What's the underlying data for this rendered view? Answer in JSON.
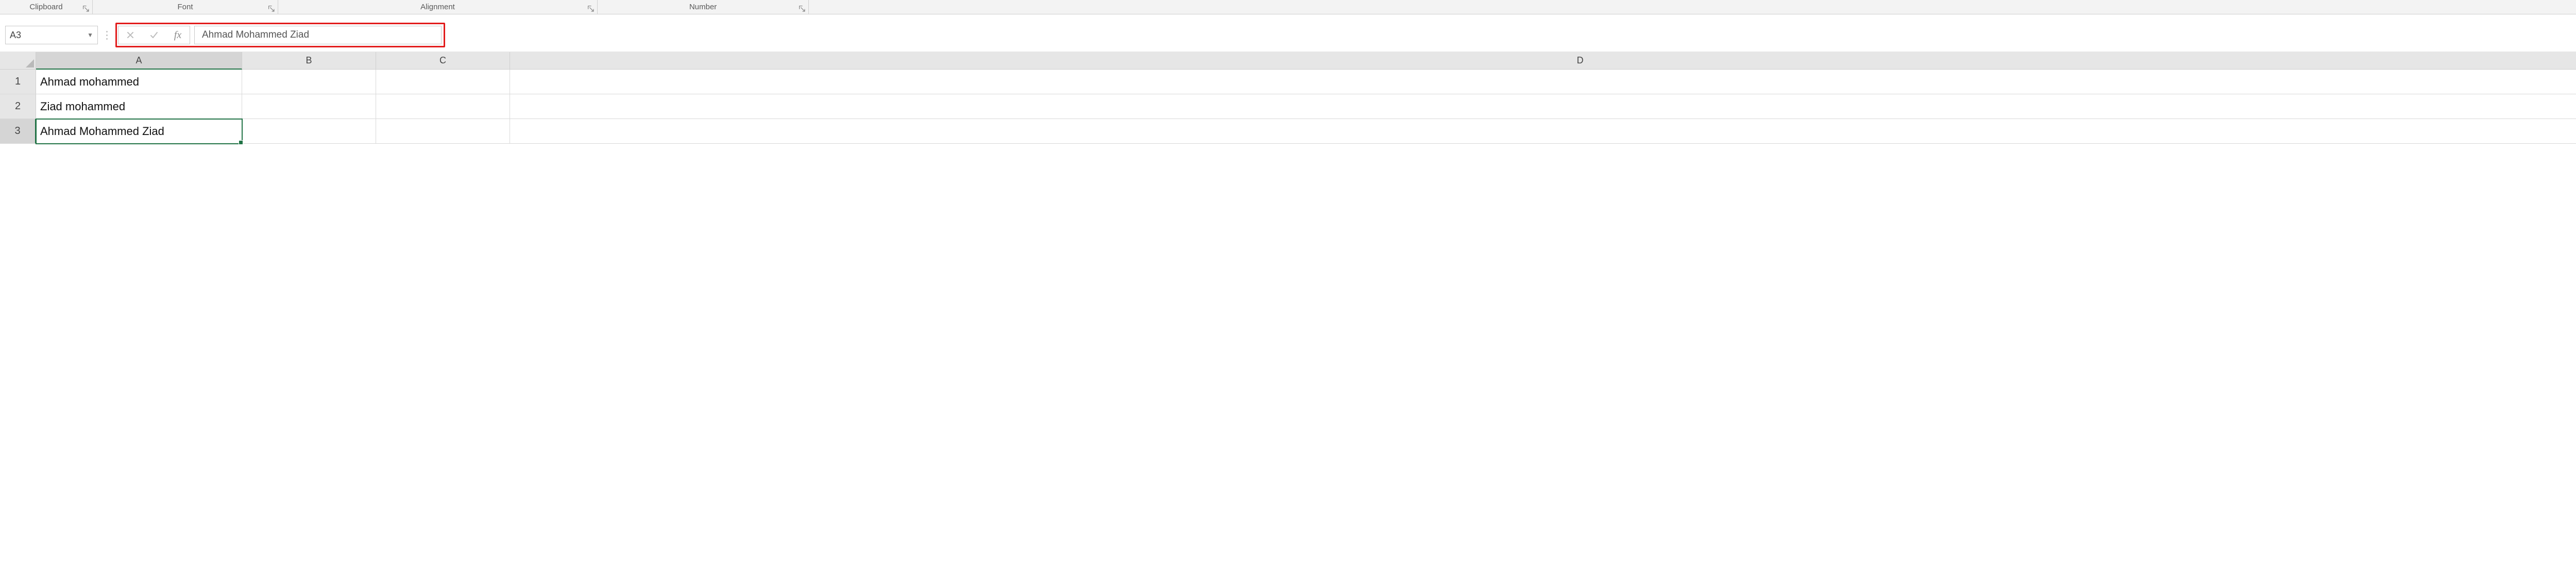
{
  "ribbon": {
    "groups": {
      "clipboard": "Clipboard",
      "font": "Font",
      "alignment": "Alignment",
      "number": "Number"
    }
  },
  "namebox": {
    "value": "A3"
  },
  "formula_bar": {
    "fx_label": "fx",
    "value": "Ahmad Mohammed Ziad"
  },
  "columns": [
    "A",
    "B",
    "C",
    "D"
  ],
  "rows": [
    {
      "n": "1",
      "A": "Ahmad mohammed",
      "B": "",
      "C": "",
      "D": ""
    },
    {
      "n": "2",
      "A": "Ziad mohammed",
      "B": "",
      "C": "",
      "D": ""
    },
    {
      "n": "3",
      "A": "Ahmad Mohammed Ziad",
      "B": "",
      "C": "",
      "D": ""
    }
  ],
  "selection": {
    "row": 3,
    "col": "A"
  }
}
